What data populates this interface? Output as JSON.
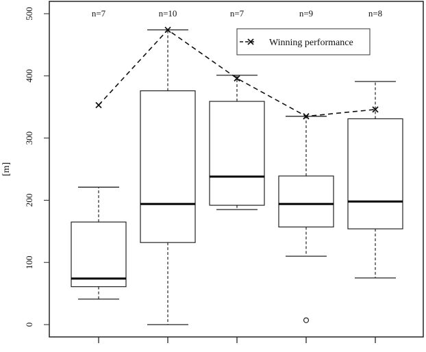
{
  "chart_data": {
    "type": "boxplot",
    "title": "",
    "xlabel": "",
    "ylabel": "[m]",
    "ylim": [
      0,
      500
    ],
    "yticks": [
      0,
      100,
      200,
      300,
      400,
      500
    ],
    "ytick_labels": [
      "0",
      "100",
      "200",
      "300",
      "400",
      "500"
    ],
    "grid": false,
    "categories": [
      "",
      "",
      "",
      "",
      ""
    ],
    "counts": [
      "n=7",
      "n=10",
      "n=7",
      "n=9",
      "n=8"
    ],
    "boxes": [
      {
        "whisker_low": 41,
        "q1": 61,
        "median": 74,
        "q3": 165,
        "whisker_high": 221,
        "outliers": []
      },
      {
        "whisker_low": 0,
        "q1": 132,
        "median": 194,
        "q3": 376,
        "whisker_high": 474,
        "outliers": []
      },
      {
        "whisker_low": 185,
        "q1": 192,
        "median": 238,
        "q3": 359,
        "whisker_high": 401,
        "outliers": []
      },
      {
        "whisker_low": 110,
        "q1": 157,
        "median": 194,
        "q3": 239,
        "whisker_high": 335,
        "outliers": [
          7
        ]
      },
      {
        "whisker_low": 75,
        "q1": 154,
        "median": 198,
        "q3": 331,
        "whisker_high": 391,
        "outliers": []
      }
    ],
    "series": [
      {
        "name": "Winning performance",
        "type": "line",
        "style": "dashed",
        "marker": "x",
        "values": [
          353,
          474,
          396,
          335,
          346
        ]
      }
    ],
    "legend": {
      "position": "top-right",
      "entries": [
        "Winning performance"
      ]
    }
  }
}
